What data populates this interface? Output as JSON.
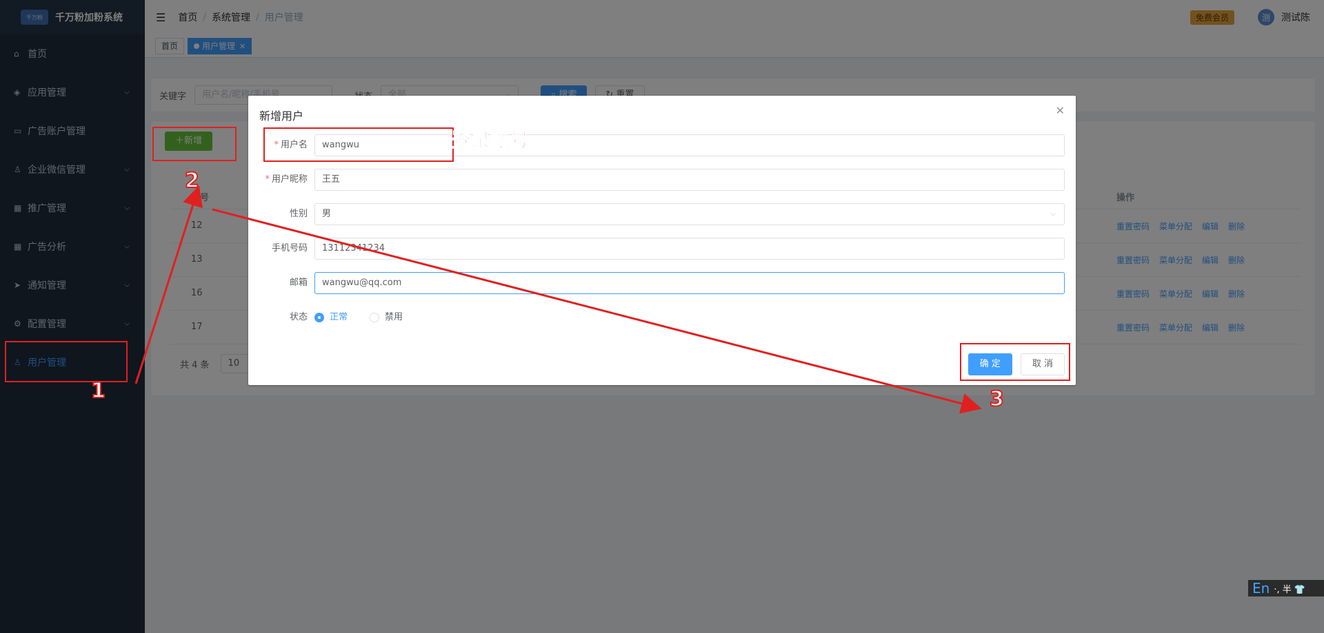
{
  "app": {
    "logo_mark": "千万粉",
    "logo_text": "千万粉加粉系统"
  },
  "sidebar": {
    "items": [
      {
        "label": "首页",
        "icon": "home-icon",
        "has_children": false
      },
      {
        "label": "应用管理",
        "icon": "layers-icon",
        "has_children": true
      },
      {
        "label": "广告账户管理",
        "icon": "monitor-icon",
        "has_children": false
      },
      {
        "label": "企业微信管理",
        "icon": "users-icon",
        "has_children": true
      },
      {
        "label": "推广管理",
        "icon": "grid-icon",
        "has_children": true
      },
      {
        "label": "广告分析",
        "icon": "grid-icon",
        "has_children": true
      },
      {
        "label": "通知管理",
        "icon": "send-icon",
        "has_children": true
      },
      {
        "label": "配置管理",
        "icon": "gear-icon",
        "has_children": true
      },
      {
        "label": "用户管理",
        "icon": "user-icon",
        "has_children": false,
        "active": true
      }
    ]
  },
  "navbar": {
    "breadcrumb": [
      "首页",
      "系统管理",
      "用户管理"
    ],
    "vip_badge": "免费会员",
    "avatar_text": "测",
    "username": "测试陈"
  },
  "tags": [
    {
      "label": "首页",
      "active": false
    },
    {
      "label": "用户管理",
      "active": true
    }
  ],
  "search": {
    "keyword_label": "关键字",
    "keyword_placeholder": "用户名/昵称/手机号",
    "status_label": "状态",
    "status_value": "全部",
    "search_button": "搜索",
    "reset_button": "重置"
  },
  "table": {
    "add_button": "新增",
    "headers": {
      "id": "序号",
      "ops": "操作"
    },
    "rows": [
      {
        "id": "12"
      },
      {
        "id": "13"
      },
      {
        "id": "16"
      },
      {
        "id": "17"
      }
    ],
    "ops": [
      "重置密码",
      "菜单分配",
      "编辑",
      "删除"
    ],
    "total": "共 4 条",
    "page_size": "10"
  },
  "dialog": {
    "title": "新增用户",
    "fields": {
      "username": {
        "label": "用户名",
        "value": "wangwu",
        "required": true
      },
      "nickname": {
        "label": "用户昵称",
        "value": "王五",
        "required": true
      },
      "gender": {
        "label": "性别",
        "value": "男"
      },
      "phone": {
        "label": "手机号码",
        "value": "13112341234"
      },
      "email": {
        "label": "邮箱",
        "value": "wangwu@qq.com"
      },
      "status": {
        "label": "状态",
        "options": [
          "正常",
          "禁用"
        ],
        "selected": "正常"
      }
    },
    "confirm": "确 定",
    "cancel": "取 消"
  },
  "annotations": {
    "login_account": "登录账号",
    "steps": [
      "1",
      "2",
      "3"
    ],
    "color": "#e02020"
  },
  "ime": {
    "lang": "En",
    "rest": "·, 半 👕"
  }
}
